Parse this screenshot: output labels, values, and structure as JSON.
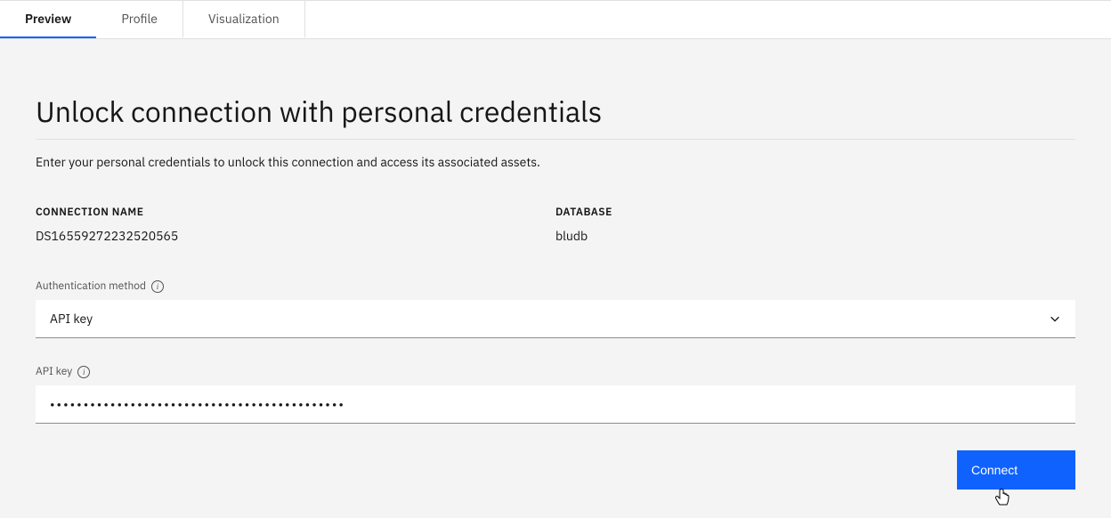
{
  "tabs": {
    "preview": "Preview",
    "profile": "Profile",
    "visualization": "Visualization"
  },
  "main": {
    "title": "Unlock connection with personal credentials",
    "description": "Enter your personal credentials to unlock this connection and access its associated assets."
  },
  "info": {
    "connectionNameLabel": "CONNECTION NAME",
    "connectionNameValue": "DS16559272232520565",
    "databaseLabel": "DATABASE",
    "databaseValue": "bludb"
  },
  "form": {
    "authMethodLabel": "Authentication method",
    "authMethodValue": "API key",
    "apiKeyLabel": "API key",
    "apiKeyValue": "••••••••••••••••••••••••••••••••••••••••••••"
  },
  "actions": {
    "connect": "Connect"
  }
}
